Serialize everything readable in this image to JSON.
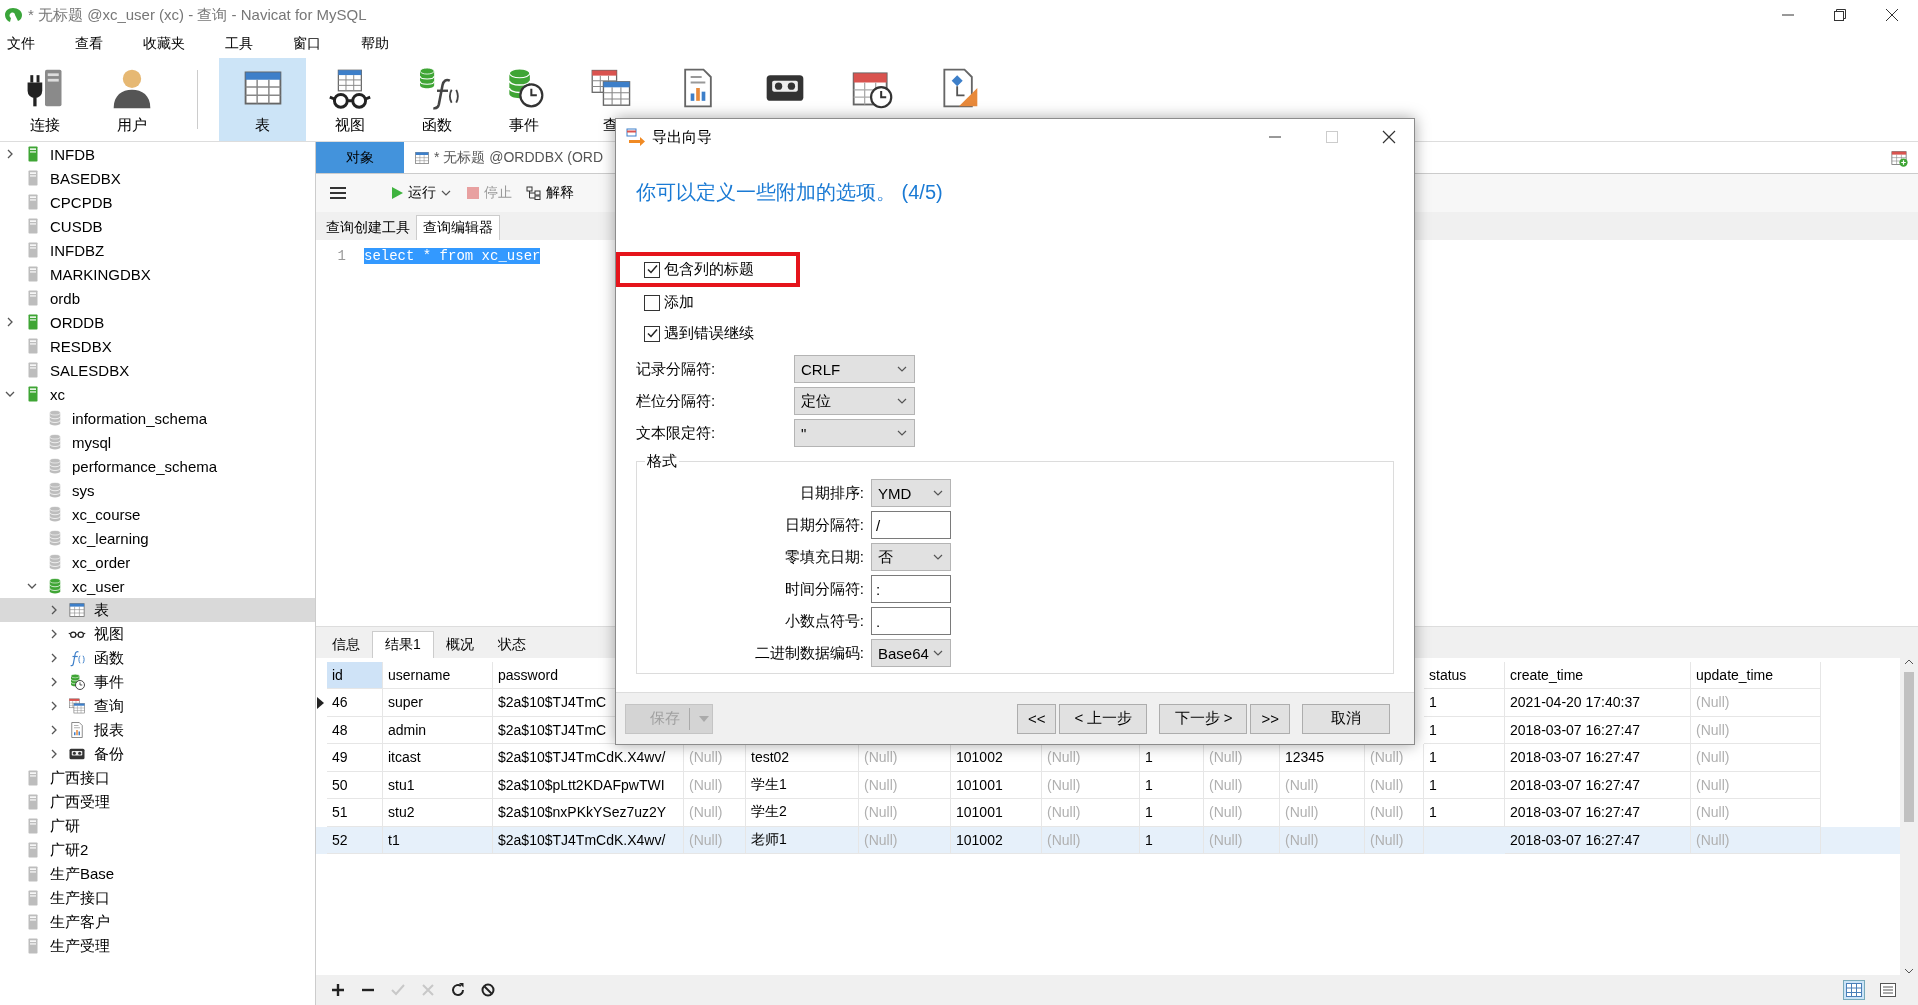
{
  "window": {
    "title": "* 无标题 @xc_user (xc) - 查询 - Navicat for MySQL"
  },
  "menu": [
    "文件",
    "查看",
    "收藏夹",
    "工具",
    "窗口",
    "帮助"
  ],
  "toolbar": [
    {
      "kind": "connection",
      "label": "连接",
      "selected": false
    },
    {
      "kind": "user",
      "label": "用户",
      "selected": false
    },
    {
      "kind": "table",
      "label": "表",
      "selected": true
    },
    {
      "kind": "view",
      "label": "视图",
      "selected": false
    },
    {
      "kind": "function",
      "label": "函数",
      "selected": false
    },
    {
      "kind": "event",
      "label": "事件",
      "selected": false
    },
    {
      "kind": "query",
      "label": "查",
      "selected": false
    },
    {
      "kind": "report",
      "selected": false
    },
    {
      "kind": "backup",
      "selected": false
    },
    {
      "kind": "schedule",
      "selected": false
    },
    {
      "kind": "model",
      "selected": false
    }
  ],
  "sidebar": {
    "items": [
      {
        "label": "INFDB",
        "kind": "connection",
        "active": true,
        "expanded": false,
        "selected": false
      },
      {
        "label": "BASEDBX",
        "kind": "connection",
        "active": false,
        "selected": false
      },
      {
        "label": "CPCPDB",
        "kind": "connection",
        "active": false,
        "selected": false
      },
      {
        "label": "CUSDB",
        "kind": "connection",
        "active": false,
        "selected": false
      },
      {
        "label": "INFDBZ",
        "kind": "connection",
        "active": false,
        "selected": false
      },
      {
        "label": "MARKINGDBX",
        "kind": "connection",
        "active": false,
        "selected": false
      },
      {
        "label": "ordb",
        "kind": "connection",
        "active": false,
        "selected": false
      },
      {
        "label": "ORDDB",
        "kind": "connection",
        "active": true,
        "expanded": false,
        "selected": false
      },
      {
        "label": "RESDBX",
        "kind": "connection",
        "active": false,
        "selected": false
      },
      {
        "label": "SALESDBX",
        "kind": "connection",
        "active": false,
        "selected": false
      },
      {
        "label": "xc",
        "kind": "connection",
        "active": true,
        "expanded": true,
        "selected": false,
        "children": [
          {
            "label": "information_schema",
            "kind": "database",
            "active": false,
            "selected": false
          },
          {
            "label": "mysql",
            "kind": "database",
            "active": false,
            "selected": false
          },
          {
            "label": "performance_schema",
            "kind": "database",
            "active": false,
            "selected": false
          },
          {
            "label": "sys",
            "kind": "database",
            "active": false,
            "selected": false
          },
          {
            "label": "xc_course",
            "kind": "database",
            "active": false,
            "selected": false
          },
          {
            "label": "xc_learning",
            "kind": "database",
            "active": false,
            "selected": false
          },
          {
            "label": "xc_order",
            "kind": "database",
            "active": false,
            "selected": false
          },
          {
            "label": "xc_user",
            "kind": "database",
            "active": true,
            "expanded": true,
            "selected": false,
            "children": [
              {
                "label": "表",
                "kind": "table",
                "expanded": false,
                "selected": true
              },
              {
                "label": "视图",
                "kind": "view",
                "expanded": false,
                "selected": false
              },
              {
                "label": "函数",
                "kind": "function",
                "expanded": false,
                "selected": false
              },
              {
                "label": "事件",
                "kind": "event",
                "expanded": false,
                "selected": false
              },
              {
                "label": "查询",
                "kind": "query",
                "expanded": false,
                "selected": false
              },
              {
                "label": "报表",
                "kind": "report",
                "expanded": false,
                "selected": false
              },
              {
                "label": "备份",
                "kind": "backup",
                "expanded": false,
                "selected": false
              }
            ]
          }
        ]
      },
      {
        "label": "广西接口",
        "kind": "connection",
        "active": false,
        "selected": false
      },
      {
        "label": "广西受理",
        "kind": "connection",
        "active": false,
        "selected": false
      },
      {
        "label": "广研",
        "kind": "connection",
        "active": false,
        "selected": false
      },
      {
        "label": "广研2",
        "kind": "connection",
        "active": false,
        "selected": false
      },
      {
        "label": "生产Base",
        "kind": "connection",
        "active": false,
        "selected": false
      },
      {
        "label": "生产接口",
        "kind": "connection",
        "active": false,
        "selected": false
      },
      {
        "label": "生产客户",
        "kind": "connection",
        "active": false,
        "selected": false
      },
      {
        "label": "生产受理",
        "kind": "connection",
        "active": false,
        "selected": false
      }
    ]
  },
  "tabs": [
    {
      "kind": "objects",
      "label": "对象",
      "selected": true
    },
    {
      "kind": "query",
      "label": "* 无标题 @ORDDBX (ORD",
      "selected": false
    }
  ],
  "query_toolbar": [
    {
      "kind": "run",
      "label": "运行",
      "disabled": false
    },
    {
      "kind": "stop",
      "label": "停止",
      "disabled": true
    },
    {
      "kind": "explain",
      "label": "解释",
      "disabled": false
    }
  ],
  "editor_tabs": [
    {
      "label": "查询创建工具",
      "selected": false
    },
    {
      "label": "查询编辑器",
      "selected": true
    }
  ],
  "editor": {
    "lines": [
      {
        "number": "1",
        "code": "select * from xc_user",
        "selected": true
      }
    ]
  },
  "result_tabs": [
    {
      "label": "信息",
      "selected": false
    },
    {
      "label": "结果1",
      "selected": true
    },
    {
      "label": "概况",
      "selected": false
    },
    {
      "label": "状态",
      "selected": false
    }
  ],
  "grid": {
    "columns": [
      {
        "label": "id",
        "selected": true
      },
      {
        "label": "username",
        "selected": false
      },
      {
        "label": "password",
        "selected": false
      }
    ],
    "end_columns": [
      {
        "label": "status",
        "selected": false
      },
      {
        "label": "create_time",
        "selected": false
      },
      {
        "label": "update_time",
        "selected": false
      }
    ],
    "rows": [
      {
        "current": true,
        "selected": false,
        "cells": [
          "46",
          "super",
          "$2a$10$TJ4TmC"
        ],
        "status": "1",
        "create_time": "2021-04-20 17:40:37",
        "update_time": {
          "text": "(Null)",
          "null": true
        }
      },
      {
        "current": false,
        "selected": false,
        "cells": [
          "48",
          "admin",
          "$2a$10$TJ4TmC"
        ],
        "status": "1",
        "create_time": "2018-03-07 16:27:47",
        "update_time": {
          "text": "(Null)",
          "null": true
        }
      },
      {
        "current": false,
        "selected": false,
        "cells": [
          "49",
          "itcast",
          "$2a$10$TJ4TmCdK.X4wv/",
          {
            "text": "(Null)",
            "null": true
          },
          "test02",
          {
            "text": "(Null)",
            "null": true
          },
          "101002",
          {
            "text": "(Null)",
            "null": true
          },
          "1",
          {
            "text": "(Null)",
            "null": true
          },
          "12345",
          {
            "text": "(Null)",
            "null": true
          }
        ],
        "status": "1",
        "create_time": "2018-03-07 16:27:47",
        "update_time": {
          "text": "(Null)",
          "null": true
        }
      },
      {
        "current": false,
        "selected": false,
        "cells": [
          "50",
          "stu1",
          "$2a$10$pLtt2KDAFpwTWI",
          {
            "text": "(Null)",
            "null": true
          },
          "学生1",
          {
            "text": "(Null)",
            "null": true
          },
          "101001",
          {
            "text": "(Null)",
            "null": true
          },
          "1",
          {
            "text": "(Null)",
            "null": true
          },
          {
            "text": "(Null)",
            "null": true
          },
          {
            "text": "(Null)",
            "null": true
          }
        ],
        "status": "1",
        "create_time": "2018-03-07 16:27:47",
        "update_time": {
          "text": "(Null)",
          "null": true
        }
      },
      {
        "current": false,
        "selected": false,
        "cells": [
          "51",
          "stu2",
          "$2a$10$nxPKkYSez7uz2Y",
          {
            "text": "(Null)",
            "null": true
          },
          "学生2",
          {
            "text": "(Null)",
            "null": true
          },
          "101001",
          {
            "text": "(Null)",
            "null": true
          },
          "1",
          {
            "text": "(Null)",
            "null": true
          },
          {
            "text": "(Null)",
            "null": true
          },
          {
            "text": "(Null)",
            "null": true
          }
        ],
        "status": "1",
        "create_time": "2018-03-07 16:27:47",
        "update_time": {
          "text": "(Null)",
          "null": true
        }
      },
      {
        "current": false,
        "selected": true,
        "cells": [
          "52",
          "t1",
          "$2a$10$TJ4TmCdK.X4wv/",
          {
            "text": "(Null)",
            "null": true
          },
          "老师1",
          {
            "text": "(Null)",
            "null": true
          },
          "101002",
          {
            "text": "(Null)",
            "null": true
          },
          "1",
          {
            "text": "(Null)",
            "null": true
          },
          {
            "text": "(Null)",
            "null": true
          },
          {
            "text": "(Null)",
            "null": true
          }
        ],
        "create_time": "2018-03-07 16:27:47",
        "update_time": {
          "text": "(Null)",
          "null": true
        }
      }
    ]
  },
  "grid_toolbar": [
    {
      "kind": "add",
      "disabled": false
    },
    {
      "kind": "remove",
      "disabled": false
    },
    {
      "kind": "apply",
      "disabled": true
    },
    {
      "kind": "discard",
      "disabled": true
    },
    {
      "kind": "refresh",
      "disabled": false
    },
    {
      "kind": "stop",
      "disabled": false
    }
  ],
  "view_modes": [
    {
      "kind": "grid",
      "selected": true
    },
    {
      "kind": "form",
      "selected": false
    }
  ],
  "dialog": {
    "title": "导出向导",
    "heading": "你可以定义一些附加的选项。 (4/5)",
    "checkboxes": [
      {
        "label": "包含列的标题",
        "checked": true,
        "highlighted": true
      },
      {
        "label": "添加",
        "checked": false,
        "highlighted": false
      },
      {
        "label": "遇到错误继续",
        "checked": true,
        "highlighted": false
      }
    ],
    "fields": [
      {
        "kind": "select",
        "label": "记录分隔符:",
        "value": "CRLF"
      },
      {
        "kind": "select",
        "label": "栏位分隔符:",
        "value": "定位"
      },
      {
        "kind": "select",
        "label": "文本限定符:",
        "value": "\""
      }
    ],
    "format": {
      "title": "格式",
      "fields": [
        {
          "kind": "select",
          "label": "日期排序:",
          "value": "YMD"
        },
        {
          "kind": "input",
          "label": "日期分隔符:",
          "value": "/"
        },
        {
          "kind": "select",
          "label": "零填充日期:",
          "value": "否"
        },
        {
          "kind": "input",
          "label": "时间分隔符:",
          "value": ":"
        },
        {
          "kind": "input",
          "label": "小数点符号:",
          "value": "."
        },
        {
          "kind": "select",
          "label": "二进制数据编码:",
          "value": "Base64"
        }
      ]
    },
    "buttons": [
      {
        "kind": "split",
        "label": "保存",
        "disabled": true
      },
      {
        "kind": "first",
        "label": "<<",
        "disabled": false
      },
      {
        "kind": "back",
        "label": "< 上一步",
        "disabled": false
      },
      {
        "kind": "next",
        "label": "下一步 >",
        "disabled": false
      },
      {
        "kind": "last",
        "label": ">>",
        "disabled": false
      },
      {
        "kind": "cancel",
        "label": "取消",
        "disabled": false
      }
    ]
  }
}
